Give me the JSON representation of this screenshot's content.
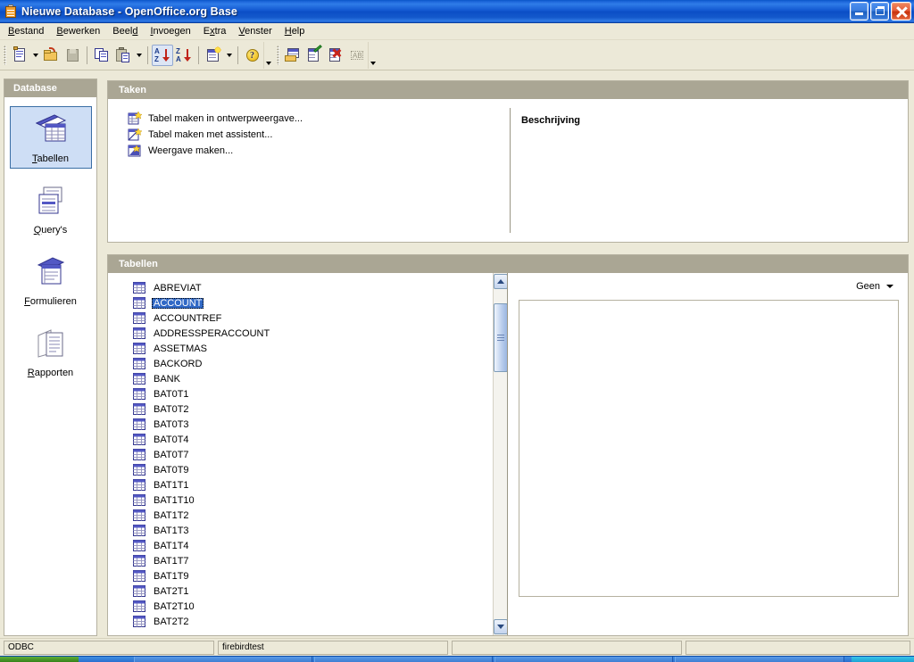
{
  "window": {
    "title": "Nieuwe Database  -  OpenOffice.org Base",
    "icon": "base-document-icon",
    "buttons": {
      "minimize": "minimize-icon",
      "maximize": "maximize-icon",
      "close": "close-icon"
    }
  },
  "menubar": [
    {
      "label": "Bestand",
      "accel": "B"
    },
    {
      "label": "Bewerken",
      "accel": "B"
    },
    {
      "label": "Beeld",
      "accel": "d"
    },
    {
      "label": "Invoegen",
      "accel": "I"
    },
    {
      "label": "Extra",
      "accel": "x"
    },
    {
      "label": "Venster",
      "accel": "V"
    },
    {
      "label": "Help",
      "accel": "H"
    }
  ],
  "toolbar": {
    "group1": [
      {
        "name": "new-document-button",
        "icon": "new-document-icon",
        "dropdown": true,
        "active": false,
        "enabled": true
      },
      {
        "name": "open-document-button",
        "icon": "open-folder-icon",
        "dropdown": false,
        "active": false,
        "enabled": true
      },
      {
        "name": "save-document-button",
        "icon": "save-disk-icon",
        "dropdown": false,
        "active": false,
        "enabled": false
      }
    ],
    "group2": [
      {
        "name": "copy-button",
        "icon": "copy-icon",
        "dropdown": false,
        "active": false,
        "enabled": true
      },
      {
        "name": "paste-button",
        "icon": "paste-icon",
        "dropdown": true,
        "active": false,
        "enabled": true
      }
    ],
    "group3": [
      {
        "name": "sort-ascending-button",
        "icon": "sort-az-icon",
        "dropdown": false,
        "active": true,
        "enabled": true
      },
      {
        "name": "sort-descending-button",
        "icon": "sort-za-icon",
        "dropdown": false,
        "active": false,
        "enabled": true
      }
    ],
    "group4": [
      {
        "name": "form-wizard-button",
        "icon": "form-new-icon",
        "dropdown": true,
        "active": false,
        "enabled": true
      }
    ],
    "group5": [
      {
        "name": "help-button",
        "icon": "help-question-icon",
        "dropdown": false,
        "active": false,
        "enabled": true
      }
    ],
    "group6": [
      {
        "name": "open-database-object-button",
        "icon": "open-table-icon",
        "dropdown": false,
        "active": false,
        "enabled": true
      },
      {
        "name": "edit-database-object-button",
        "icon": "edit-table-icon",
        "dropdown": false,
        "active": false,
        "enabled": true
      },
      {
        "name": "delete-database-object-button",
        "icon": "delete-table-icon",
        "dropdown": false,
        "active": false,
        "enabled": true
      },
      {
        "name": "rename-database-object-button",
        "icon": "rename-ab-icon",
        "dropdown": false,
        "active": false,
        "enabled": false
      }
    ]
  },
  "sidebar": {
    "header": "Database",
    "items": [
      {
        "label": "Tabellen",
        "accel": "T",
        "icon": "tables-icon",
        "selected": true
      },
      {
        "label": "Query's",
        "accel": "Q",
        "icon": "queries-icon",
        "selected": false
      },
      {
        "label": "Formulieren",
        "accel": "F",
        "icon": "forms-icon",
        "selected": false
      },
      {
        "label": "Rapporten",
        "accel": "R",
        "icon": "reports-icon",
        "selected": false
      }
    ]
  },
  "taken_panel": {
    "header": "Taken",
    "tasks": [
      {
        "label": "Tabel maken in ontwerpweergave...",
        "icon": "table-design-icon"
      },
      {
        "label": "Tabel maken met assistent...",
        "icon": "table-wizard-icon"
      },
      {
        "label": "Weergave maken...",
        "icon": "create-view-icon"
      }
    ],
    "description_title": "Beschrijving",
    "description_text": ""
  },
  "tabellen_panel": {
    "header": "Tabellen",
    "selected_table": "ACCOUNT",
    "tables": [
      "ABREVIAT",
      "ACCOUNT",
      "ACCOUNTREF",
      "ADDRESSPERACCOUNT",
      "ASSETMAS",
      "BACKORD",
      "BANK",
      "BAT0T1",
      "BAT0T2",
      "BAT0T3",
      "BAT0T4",
      "BAT0T7",
      "BAT0T9",
      "BAT1T1",
      "BAT1T10",
      "BAT1T2",
      "BAT1T3",
      "BAT1T4",
      "BAT1T7",
      "BAT1T9",
      "BAT2T1",
      "BAT2T10",
      "BAT2T2"
    ],
    "preview": {
      "mode_label": "Geen",
      "content": ""
    },
    "scrollbar": {
      "up_icon": "scroll-up-icon",
      "down_icon": "scroll-down-icon",
      "thumb_position_pct": 5
    }
  },
  "statusbar": {
    "cells": [
      "ODBC",
      "firebirdtest",
      "",
      ""
    ]
  },
  "colors": {
    "titlebar_blue": "#1157cf",
    "panel_header": "#aaa694",
    "selection_blue": "#3169c6",
    "sidebar_selected": "#cedef5",
    "window_face": "#ece9d8"
  }
}
